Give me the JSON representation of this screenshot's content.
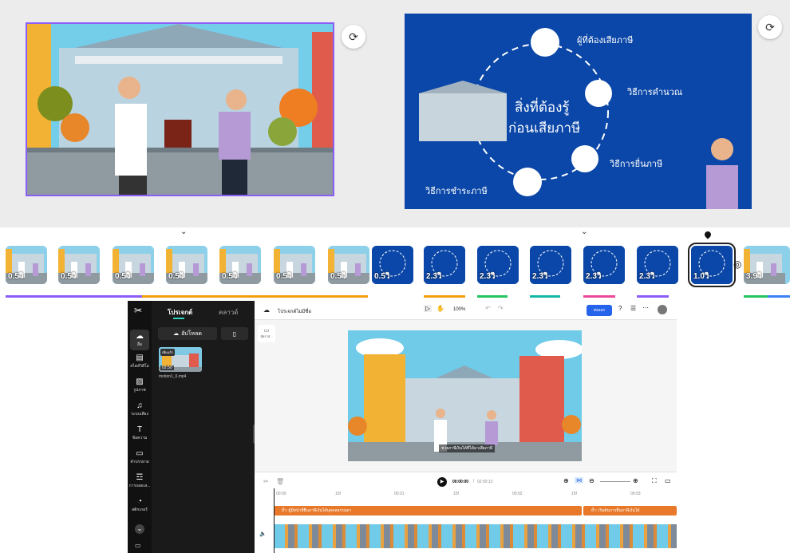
{
  "slide1": {
    "refresh_icon": "refresh-ai-icon"
  },
  "slide2": {
    "center_title_line1": "สิ่งที่ต้องรู้",
    "center_title_line2": "ก่อนเสียภาษี",
    "item_top": "ผู้ที่ต้องเสียภาษี",
    "item_right1": "วิธีการคำนวณ",
    "item_right2": "วิธีการยื่นภาษี",
    "item_left": "วิธีการชำระภาษี"
  },
  "strip": {
    "thumbs": [
      {
        "dur": "0.5วิ",
        "kind": "a"
      },
      {
        "dur": "0.5วิ",
        "kind": "a"
      },
      {
        "dur": "0.5วิ",
        "kind": "a"
      },
      {
        "dur": "0.5วิ",
        "kind": "a"
      },
      {
        "dur": "0.5วิ",
        "kind": "a"
      },
      {
        "dur": "0.5วิ",
        "kind": "a"
      },
      {
        "dur": "0.5วิ",
        "kind": "a"
      },
      {
        "dur": "0.5วิ",
        "kind": "b"
      },
      {
        "dur": "2.3วิ",
        "kind": "b"
      },
      {
        "dur": "2.3วิ",
        "kind": "b"
      },
      {
        "dur": "2.3วิ",
        "kind": "b"
      },
      {
        "dur": "2.3วิ",
        "kind": "b"
      },
      {
        "dur": "2.3วิ",
        "kind": "b"
      },
      {
        "dur": "1.0วิ",
        "kind": "b"
      },
      {
        "dur": "3.9วิ",
        "kind": "a"
      }
    ],
    "colors": {
      "purple": "#8b5cf6",
      "orange": "#f59e0b",
      "green": "#22c55e",
      "teal": "#14b8a6",
      "pink": "#ec4899",
      "blue": "#3b82f6"
    }
  },
  "editor": {
    "nav": [
      {
        "label": "สื่อ",
        "icon": "media-icon"
      },
      {
        "label": "สไตล์วิดีโอ",
        "icon": "video-style-icon"
      },
      {
        "label": "รูปภาพ",
        "icon": "image-icon"
      },
      {
        "label": "ระบบเสียง",
        "icon": "audio-icon"
      },
      {
        "label": "ข้อความ",
        "icon": "text-icon"
      },
      {
        "label": "คำบรรยาย",
        "icon": "caption-icon"
      },
      {
        "label": "การถอดเส...",
        "icon": "transcript-icon"
      },
      {
        "label": "สติกเกอร์",
        "icon": "sticker-icon"
      }
    ],
    "tab_project": "โปรเจกต์",
    "tab_cloud": "คลาวด์",
    "upload_label": "อัปโหลด",
    "media_file": "motion1_6.mp4",
    "media_tag": "เพิ่มแล้ว",
    "media_duration": "02:50",
    "project_title": "โปรเจกต์ไม่มีชื่อ",
    "zoom": "100%",
    "export_label": "ส่งออก",
    "aspect_label": "อัตราส่...",
    "subtitle_text": "ช่วยภาษีเงินได้ที่ได้มาเสียภาษี",
    "time_current": "00:00:00",
    "time_total": "02:50:13",
    "ruler": [
      "00:00",
      "15f",
      "00:01",
      "15f",
      "00:02",
      "15f",
      "00:03"
    ],
    "track1_text": "ย้ำ: ผู้มีหน้าที่ยื่นภาษีเงินได้บุคคลธรรมดา",
    "track2_text": "ย้ำ: เริ่มต้นการยื่นภาษีเงินได้"
  }
}
